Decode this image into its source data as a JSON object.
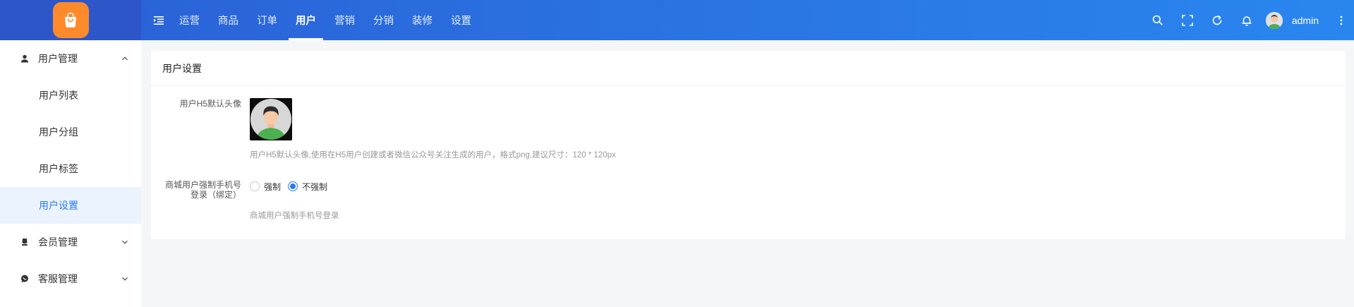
{
  "header": {
    "nav": [
      {
        "label": "运营",
        "active": false
      },
      {
        "label": "商品",
        "active": false
      },
      {
        "label": "订单",
        "active": false
      },
      {
        "label": "用户",
        "active": true
      },
      {
        "label": "营销",
        "active": false
      },
      {
        "label": "分销",
        "active": false
      },
      {
        "label": "装修",
        "active": false
      },
      {
        "label": "设置",
        "active": false
      }
    ],
    "username": "admin",
    "icons": [
      "search-icon",
      "fullscreen-icon",
      "refresh-icon",
      "bell-icon",
      "more-vertical-icon"
    ]
  },
  "sidebar": {
    "groups": [
      {
        "label": "用户管理",
        "icon": "user-icon",
        "expanded": true,
        "items": [
          {
            "label": "用户列表",
            "active": false
          },
          {
            "label": "用户分组",
            "active": false
          },
          {
            "label": "用户标签",
            "active": false
          },
          {
            "label": "用户设置",
            "active": true
          }
        ]
      },
      {
        "label": "会员管理",
        "icon": "member-icon",
        "expanded": false,
        "items": []
      },
      {
        "label": "客服管理",
        "icon": "chat-icon",
        "expanded": false,
        "items": []
      }
    ]
  },
  "main": {
    "title": "用户设置",
    "fields": {
      "avatar": {
        "label": "用户H5默认头像",
        "hint": "用户H5默认头像,使用在H5用户创建或者微信公众号关注生成的用户，格式png,建议尺寸：120 * 120px"
      },
      "force_phone": {
        "label_line1": "商城用户强制手机号",
        "label_line2": "登录（绑定）",
        "options": [
          {
            "label": "强制",
            "checked": false
          },
          {
            "label": "不强制",
            "checked": true
          }
        ],
        "hint": "商城用户强制手机号登录"
      }
    }
  },
  "colors": {
    "header_start": "#2a5fd6",
    "header_end": "#2a86ef",
    "accent": "#2a7cf3",
    "logo": "#ff8a2b",
    "active_bg": "#ebf3fe"
  }
}
